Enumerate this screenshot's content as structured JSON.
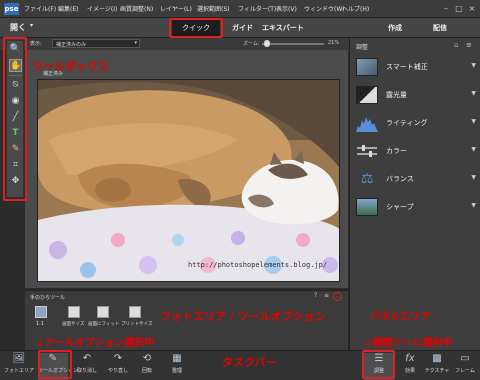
{
  "menubar": {
    "logo": "pse",
    "items": [
      "ファイル(F)",
      "編集(E)",
      "イメージ(I)",
      "画質調整(N)",
      "レイヤー(L)",
      "選択範囲(S)",
      "フィルター(T)",
      "表示(V)",
      "ウィンドウ(W)",
      "ヘルプ(H)"
    ]
  },
  "modebar": {
    "open_label": "開く",
    "tabs": [
      "クイック",
      "ガイド",
      "エキスパート"
    ],
    "create_label": "作成",
    "share_label": "配信"
  },
  "options_row": {
    "view_label": "表示:",
    "view_value": "補正済みのみ",
    "zoom_label": "ズーム:",
    "zoom_value": "21%"
  },
  "canvas": {
    "doc_label": "補正済み",
    "watermark": "http://photoshopelements.blog.jp/"
  },
  "panel": {
    "title": "調整",
    "items": [
      "スマート補正",
      "露光量",
      "ライティング",
      "カラー",
      "バランス",
      "シャープ"
    ]
  },
  "tool_options": {
    "title": "手のひらツール",
    "zoom_value": "1:1",
    "buttons": [
      "画面サイズ",
      "画面にフィット",
      "プリントサイズ"
    ]
  },
  "taskbar": {
    "left": [
      "フォトエリア",
      "ツールオプション",
      "取り消し",
      "やり直し",
      "回転",
      "整理"
    ],
    "right": [
      "調整",
      "効果",
      "テクスチャ",
      "フレーム"
    ]
  },
  "annotations": {
    "toolbox": "ツールボックス",
    "photo_area": "フォトエリア / ツールオプション",
    "panel_area": "パネルエリア",
    "tool_options_selected": "↓ツールオプション選択中",
    "taskbar": "タスクバー",
    "adjust_selected": "↓調整ツール選択中"
  },
  "colors": {
    "accent_red": "#e60000",
    "ui_dark": "#3c3c3c"
  }
}
